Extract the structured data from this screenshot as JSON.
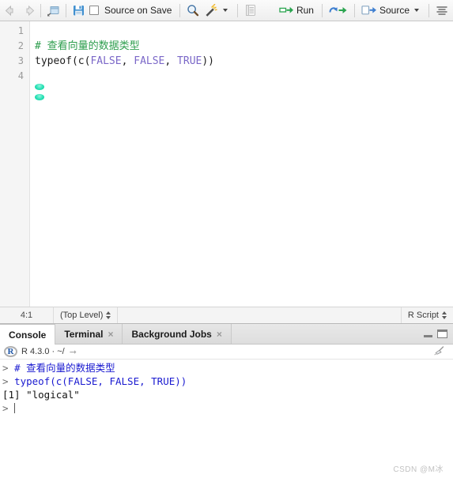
{
  "editor_toolbar": {
    "back_icon": "back-arrow-icon",
    "forward_icon": "forward-arrow-icon",
    "popout_icon": "show-in-new-window-icon",
    "save_icon": "save-icon",
    "source_on_save_label": "Source on Save",
    "find_icon": "find-replace-icon",
    "code_tools_icon": "magic-wand-icon",
    "compile_report_icon": "compile-report-icon",
    "run_label": "Run",
    "rerun_icon": "rerun-previous-icon",
    "source_label": "Source",
    "outline_icon": "document-outline-icon"
  },
  "editor": {
    "line_numbers": [
      "1",
      "2",
      "3",
      "4"
    ],
    "lines": [
      {
        "tokens": []
      },
      {
        "tokens": [
          {
            "text": "# 查看向量的数据类型",
            "type": "comment"
          }
        ]
      },
      {
        "tokens": [
          {
            "text": "typeof(c(",
            "type": "plain"
          },
          {
            "text": "FALSE",
            "type": "const"
          },
          {
            "text": ", ",
            "type": "plain"
          },
          {
            "text": "FALSE",
            "type": "const"
          },
          {
            "text": ", ",
            "type": "plain"
          },
          {
            "text": "TRUE",
            "type": "const"
          },
          {
            "text": "))",
            "type": "plain"
          }
        ]
      },
      {
        "tokens": []
      }
    ]
  },
  "editor_status": {
    "cursor_position": "4:1",
    "scope": "(Top Level)",
    "file_type": "R Script"
  },
  "console_tabs": [
    {
      "label": "Console",
      "closable": false,
      "active": true
    },
    {
      "label": "Terminal",
      "closable": true,
      "active": false
    },
    {
      "label": "Background Jobs",
      "closable": true,
      "active": false
    }
  ],
  "console_window_controls": {
    "minimize_icon": "minimize-pane-icon",
    "maximize_icon": "maximize-pane-icon"
  },
  "console_header": {
    "r_logo_letter": "R",
    "version_path": "R 4.3.0 · ~/",
    "expand_arrow_icon": "expand-arrow-icon",
    "clear_console_icon": "broom-clear-console-icon"
  },
  "console_lines": [
    {
      "prompt": "> ",
      "segments": [
        {
          "text": "# 查看向量的数据类型",
          "type": "input"
        }
      ]
    },
    {
      "prompt": "> ",
      "segments": [
        {
          "text": "typeof(c(FALSE, FALSE, TRUE))",
          "type": "input"
        }
      ]
    },
    {
      "prompt": "",
      "segments": [
        {
          "text": "[1] \"logical\"",
          "type": "output"
        }
      ]
    },
    {
      "prompt": "> ",
      "segments": [],
      "caret": true
    }
  ],
  "watermark": {
    "text": "CSDN @M冰"
  },
  "colors": {
    "comment_green": "#2e9e4e",
    "constant_purple": "#7b68c8",
    "console_input_blue": "#1a1ad0",
    "accent_blue": "#2158a8",
    "run_green": "#2aa44f",
    "cursor_teal": "#27e0b4"
  }
}
